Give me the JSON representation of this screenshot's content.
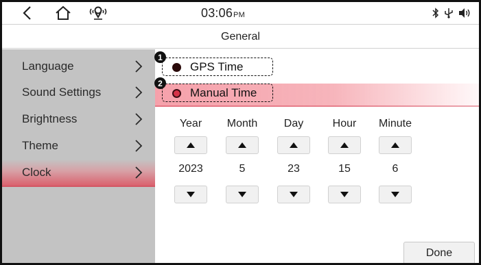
{
  "status": {
    "time": "03:06",
    "ampm": "PM",
    "icons": [
      "back-icon",
      "home-icon",
      "navigation-icon",
      "bluetooth-icon",
      "usb-icon",
      "volume-icon"
    ]
  },
  "header": {
    "title": "General"
  },
  "sidebar": {
    "items": [
      {
        "label": "Language",
        "active": false
      },
      {
        "label": "Sound Settings",
        "active": false
      },
      {
        "label": "Brightness",
        "active": false
      },
      {
        "label": "Theme",
        "active": false
      },
      {
        "label": "Clock",
        "active": true
      }
    ],
    "chevron": ">"
  },
  "time_mode": {
    "options": [
      {
        "badge": "1",
        "label": "GPS Time",
        "selected": false
      },
      {
        "badge": "2",
        "label": "Manual Time",
        "selected": true
      }
    ]
  },
  "clock_fields": {
    "columns": [
      {
        "label": "Year",
        "value": "2023"
      },
      {
        "label": "Month",
        "value": "5"
      },
      {
        "label": "Day",
        "value": "23"
      },
      {
        "label": "Hour",
        "value": "15"
      },
      {
        "label": "Minute",
        "value": "6"
      }
    ]
  },
  "actions": {
    "done_label": "Done"
  },
  "colors": {
    "accent": "#d53247",
    "sidebar_bg": "#c3c3c3"
  }
}
